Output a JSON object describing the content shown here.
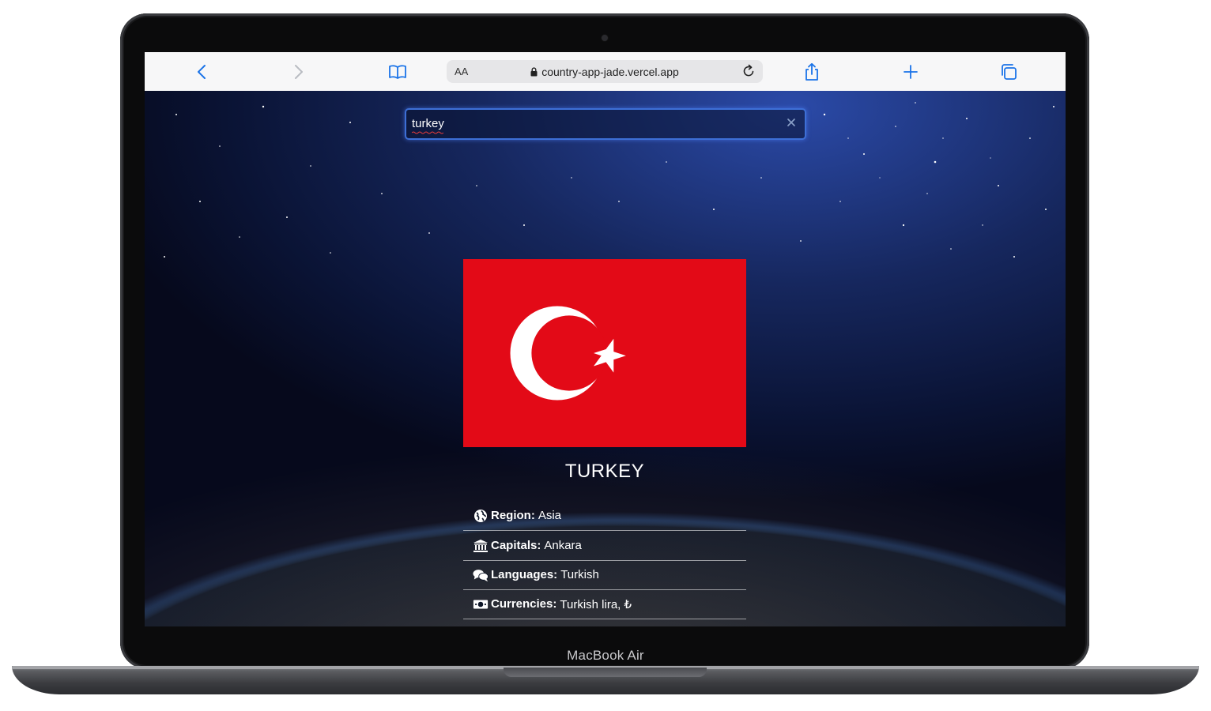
{
  "device": {
    "model_label": "MacBook Air"
  },
  "browser": {
    "url_prefix": "AA",
    "url": "country-app-jade.vercel.app",
    "icons": [
      "back-icon",
      "forward-icon",
      "bookmarks-icon",
      "lock-icon",
      "reload-icon",
      "share-icon",
      "new-tab-icon",
      "tabs-icon"
    ]
  },
  "search": {
    "value": "turkey"
  },
  "country": {
    "name": "TURKEY",
    "flag": {
      "background": "#E30A17",
      "emblem": "crescent-and-star",
      "emblem_color": "#ffffff"
    },
    "info": [
      {
        "icon": "globe-icon",
        "label": "Region:",
        "value": "Asia"
      },
      {
        "icon": "landmark-icon",
        "label": "Capitals:",
        "value": "Ankara"
      },
      {
        "icon": "comments-icon",
        "label": "Languages:",
        "value": "Turkish"
      },
      {
        "icon": "money-icon",
        "label": "Currencies:",
        "value": "Turkish lira, ₺"
      }
    ]
  },
  "colors": {
    "accent": "#1a73e8",
    "search_border": "#3d6fd6",
    "flag_red": "#E30A17"
  }
}
